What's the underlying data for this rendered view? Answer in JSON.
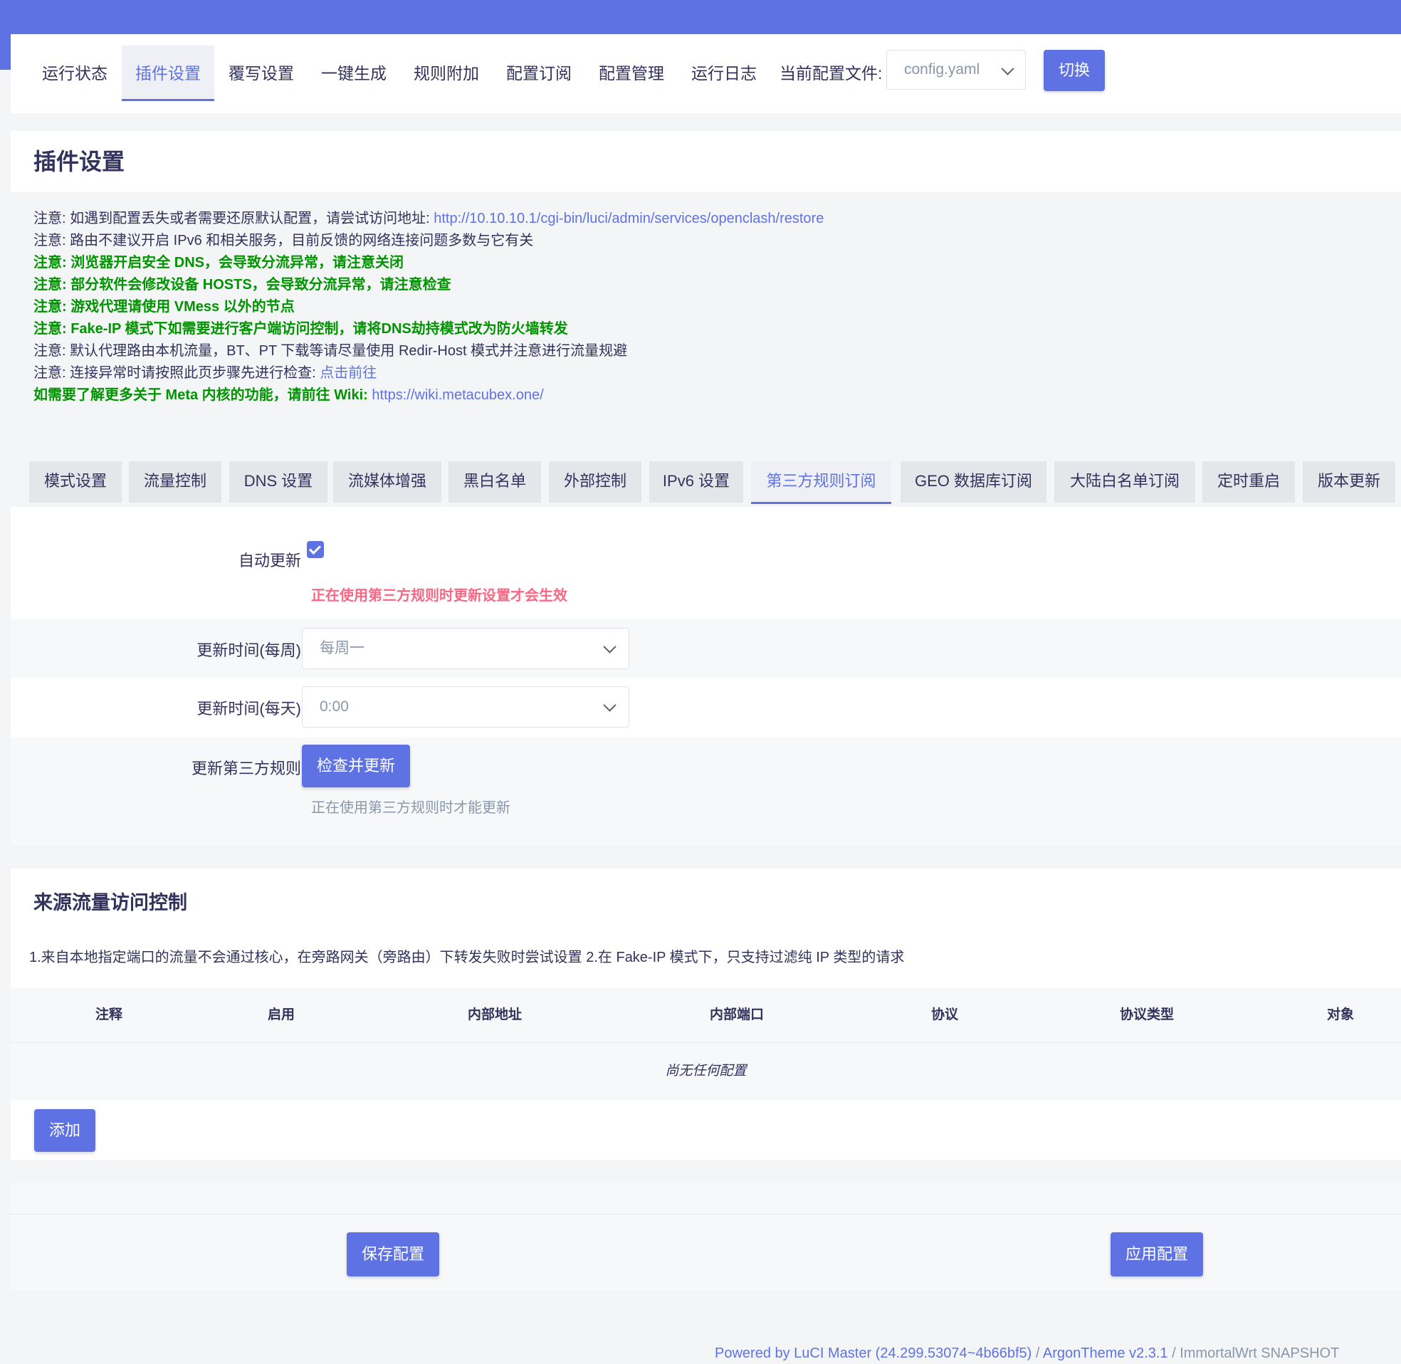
{
  "nav": {
    "tabs": [
      "运行状态",
      "插件设置",
      "覆写设置",
      "一键生成",
      "规则附加",
      "配置订阅",
      "配置管理",
      "运行日志"
    ],
    "config_label": "当前配置文件:",
    "config_value": "config.yaml",
    "switch_button": "切换"
  },
  "page": {
    "title": "插件设置"
  },
  "notices": [
    {
      "text": "注意: 如遇到配置丢失或者需要还原默认配置，请尝试访问地址: ",
      "link": "http://10.10.10.1/cgi-bin/luci/admin/services/openclash/restore"
    },
    {
      "text": "注意: 路由不建议开启 IPv6 和相关服务，目前反馈的网络连接问题多数与它有关"
    },
    {
      "text": "注意: 浏览器开启安全 DNS，会导致分流异常，请注意关闭"
    },
    {
      "text": "注意: 部分软件会修改设备 HOSTS，会导致分流异常，请注意检查"
    },
    {
      "text": "注意: 游戏代理请使用 VMess 以外的节点"
    },
    {
      "text": "注意: Fake-IP 模式下如需要进行客户端访问控制，请将DNS劫持模式改为防火墙转发"
    },
    {
      "text": "注意: 默认代理路由本机流量，BT、PT 下载等请尽量使用 Redir-Host 模式并注意进行流量规避"
    },
    {
      "text": "注意: 连接异常时请按照此页步骤先进行检查: ",
      "link": "点击前往"
    },
    {
      "text": "如需要了解更多关于 Meta 内核的功能，请前往 Wiki: ",
      "link": "https://wiki.metacubex.one/"
    }
  ],
  "subtabs": [
    "模式设置",
    "流量控制",
    "DNS 设置",
    "流媒体增强",
    "黑白名单",
    "外部控制",
    "IPv6 设置",
    "第三方规则订阅",
    "GEO 数据库订阅",
    "大陆白名单订阅",
    "定时重启",
    "版本更新"
  ],
  "rules": {
    "auto_update_label": "自动更新",
    "auto_update_checked": true,
    "auto_update_note": "正在使用第三方规则时更新设置才会生效",
    "weekly_label": "更新时间(每周)",
    "weekly_value": "每周一",
    "daily_label": "更新时间(每天)",
    "daily_value": "0:00",
    "update_label": "更新第三方规则",
    "update_button": "检查并更新",
    "update_note": "正在使用第三方规则时才能更新"
  },
  "access": {
    "title": "来源流量访问控制",
    "description": "1.来自本地指定端口的流量不会通过核心，在旁路网关（旁路由）下转发失败时尝试设置 2.在 Fake-IP 模式下，只支持过滤纯 IP 类型的请求",
    "columns": [
      "注释",
      "启用",
      "内部地址",
      "内部端口",
      "协议",
      "协议类型",
      "对象"
    ],
    "empty": "尚无任何配置",
    "add_button": "添加"
  },
  "actions": {
    "save": "保存配置",
    "apply": "应用配置"
  },
  "footer": {
    "luci": "Powered by LuCI Master (24.299.53074~4b66bf5)",
    "sep": " / ",
    "theme": "ArgonTheme v2.3.1",
    "os": "ImmortalWrt SNAPSHOT"
  },
  "colors": {
    "accent": "#5e72e4",
    "notice_green": "#009400",
    "warning": "#f5365c"
  }
}
